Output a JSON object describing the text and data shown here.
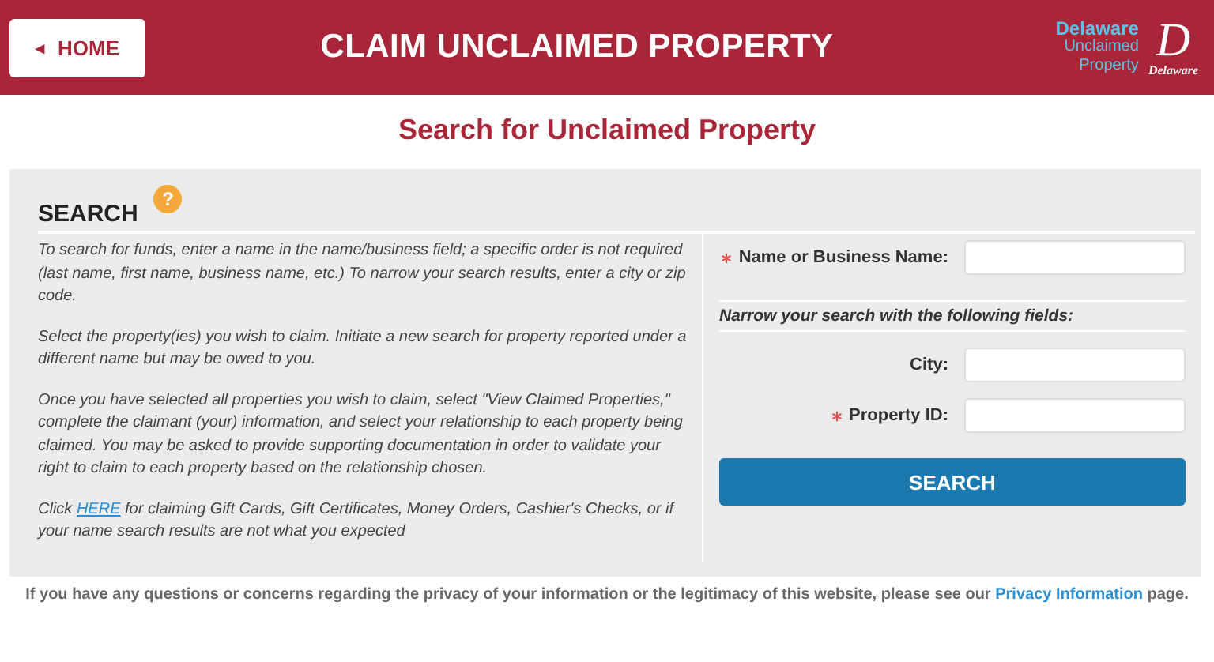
{
  "header": {
    "home_button": {
      "icon": "◂",
      "label": "HOME"
    },
    "title": "CLAIM UNCLAIMED PROPERTY",
    "logo": {
      "lines": [
        "Delaware",
        "Unclaimed",
        "Property"
      ],
      "monogram": "D",
      "monogram_caption": "Delaware"
    }
  },
  "page_title": "Search for Unclaimed Property",
  "search": {
    "heading": "SEARCH",
    "help_icon": "?",
    "paragraphs": [
      {
        "text": "To search for funds, enter a name in the name/business field; a specific order is not required (last name, first name, business name, etc.) To narrow your search results, enter a city or zip code."
      },
      {
        "text": "Select the property(ies) you wish to claim. Initiate a new search for property reported under a different name but may be owed to you."
      },
      {
        "text": "Once you have selected all properties you wish to claim, select \"View Claimed Properties,\" complete the claimant (your) information, and select your relationship to each property being claimed. You may be asked to provide supporting documentation in order to validate your right to claim to each property based on the relationship chosen."
      },
      {
        "before": "Click ",
        "link": "HERE",
        "after": " for claiming Gift Cards, Gift Certificates, Money Orders, Cashier's Checks, or if your name search results are not what you expected"
      }
    ],
    "form": [
      {
        "kind": "field",
        "label": "Name or Business Name:",
        "required": true
      },
      {
        "kind": "note",
        "label": "Narrow your search with the following fields:"
      },
      {
        "kind": "field",
        "label": "City:",
        "required": false
      },
      {
        "kind": "field",
        "label": "Property ID:",
        "required": true
      }
    ],
    "button": "SEARCH"
  },
  "footer": {
    "before": "If you have any questions or concerns regarding the privacy of your information or the legitimacy of this website, please see our ",
    "link": "Privacy Information",
    "after": " page."
  }
}
